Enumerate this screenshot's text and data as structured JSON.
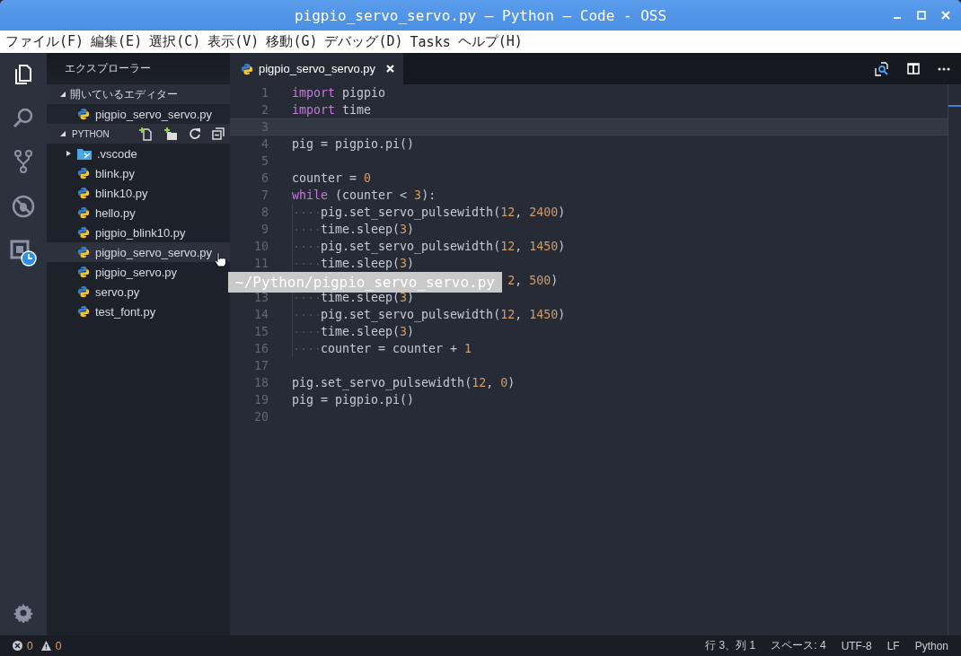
{
  "window": {
    "title": "pigpio_servo_servo.py — Python — Code - OSS"
  },
  "menu": [
    "ファイル(F)",
    "編集(E)",
    "選択(C)",
    "表示(V)",
    "移動(G)",
    "デバッグ(D)",
    "Tasks",
    "ヘルプ(H)"
  ],
  "sidebar": {
    "title": "エクスプローラー",
    "open_editors": {
      "label": "開いているエディター",
      "expanded": true,
      "files": [
        {
          "name": "pigpio_servo_servo.py",
          "hovered": false
        }
      ]
    },
    "folder": {
      "label": "PYTHON",
      "expanded": true,
      "items": [
        {
          "name": ".vscode",
          "kind": "folder",
          "expanded": false,
          "hovered": false
        },
        {
          "name": "blink.py",
          "kind": "file",
          "hovered": false
        },
        {
          "name": "blink10.py",
          "kind": "file",
          "hovered": false
        },
        {
          "name": "hello.py",
          "kind": "file",
          "hovered": false
        },
        {
          "name": "pigpio_blink10.py",
          "kind": "file",
          "hovered": false
        },
        {
          "name": "pigpio_servo_servo.py",
          "kind": "file",
          "hovered": true
        },
        {
          "name": "pigpio_servo.py",
          "kind": "file",
          "hovered": false
        },
        {
          "name": "servo.py",
          "kind": "file",
          "hovered": false
        },
        {
          "name": "test_font.py",
          "kind": "file",
          "hovered": false
        }
      ]
    }
  },
  "tabs": [
    {
      "label": "pigpio_servo_servo.py",
      "selected": true
    }
  ],
  "editor": {
    "lines": [
      {
        "number": "1",
        "current": false,
        "indented": false,
        "tokens": [
          {
            "text": "import",
            "kind": "keyword"
          },
          {
            "text": " pigpio",
            "kind": "plain"
          }
        ]
      },
      {
        "number": "2",
        "current": false,
        "indented": false,
        "tokens": [
          {
            "text": "import",
            "kind": "keyword"
          },
          {
            "text": " time",
            "kind": "plain"
          }
        ]
      },
      {
        "number": "3",
        "current": true,
        "indented": false
      },
      {
        "number": "4",
        "current": false,
        "indented": false,
        "tokens": [
          {
            "text": "pig = pigpio.pi()",
            "kind": "plain"
          }
        ]
      },
      {
        "number": "5",
        "current": false,
        "indented": false
      },
      {
        "number": "6",
        "current": false,
        "indented": false,
        "tokens": [
          {
            "text": "counter = ",
            "kind": "plain"
          },
          {
            "text": "0",
            "kind": "number"
          }
        ]
      },
      {
        "number": "7",
        "current": false,
        "indented": false,
        "tokens": [
          {
            "text": "while",
            "kind": "keyword"
          },
          {
            "text": " (counter < ",
            "kind": "plain"
          },
          {
            "text": "3",
            "kind": "number"
          },
          {
            "text": "):",
            "kind": "plain"
          }
        ]
      },
      {
        "number": "8",
        "current": false,
        "indented": true,
        "tokens": [
          {
            "text": "pig.set_servo_pulsewidth(",
            "kind": "plain"
          },
          {
            "text": "12",
            "kind": "number"
          },
          {
            "text": ", ",
            "kind": "plain"
          },
          {
            "text": "2400",
            "kind": "number"
          },
          {
            "text": ")",
            "kind": "plain"
          }
        ]
      },
      {
        "number": "9",
        "current": false,
        "indented": true,
        "tokens": [
          {
            "text": "time.sleep(",
            "kind": "plain"
          },
          {
            "text": "3",
            "kind": "number"
          },
          {
            "text": ")",
            "kind": "plain"
          }
        ]
      },
      {
        "number": "10",
        "current": false,
        "indented": true,
        "tokens": [
          {
            "text": "pig.set_servo_pulsewidth(",
            "kind": "plain"
          },
          {
            "text": "12",
            "kind": "number"
          },
          {
            "text": ", ",
            "kind": "plain"
          },
          {
            "text": "1450",
            "kind": "number"
          },
          {
            "text": ")",
            "kind": "plain"
          }
        ]
      },
      {
        "number": "11",
        "current": false,
        "indented": true,
        "tokens": [
          {
            "text": "time.sleep(",
            "kind": "plain"
          },
          {
            "text": "3",
            "kind": "number"
          },
          {
            "text": ")",
            "kind": "plain"
          }
        ]
      },
      {
        "covered": true,
        "current": false,
        "tokens": [
          {
            "text": "2",
            "kind": "number"
          },
          {
            "text": ", ",
            "kind": "plain"
          },
          {
            "text": "500",
            "kind": "number"
          },
          {
            "text": ")",
            "kind": "plain"
          }
        ]
      },
      {
        "number": "13",
        "current": false,
        "indented": true,
        "tokens": [
          {
            "text": "time.sleep(",
            "kind": "plain"
          },
          {
            "text": "3",
            "kind": "number"
          },
          {
            "text": ")",
            "kind": "plain"
          }
        ]
      },
      {
        "number": "14",
        "current": false,
        "indented": true,
        "tokens": [
          {
            "text": "pig.set_servo_pulsewidth(",
            "kind": "plain"
          },
          {
            "text": "12",
            "kind": "number"
          },
          {
            "text": ", ",
            "kind": "plain"
          },
          {
            "text": "1450",
            "kind": "number"
          },
          {
            "text": ")",
            "kind": "plain"
          }
        ]
      },
      {
        "number": "15",
        "current": false,
        "indented": true,
        "tokens": [
          {
            "text": "time.sleep(",
            "kind": "plain"
          },
          {
            "text": "3",
            "kind": "number"
          },
          {
            "text": ")",
            "kind": "plain"
          }
        ]
      },
      {
        "number": "16",
        "current": false,
        "indented": true,
        "tokens": [
          {
            "text": "counter = counter + ",
            "kind": "plain"
          },
          {
            "text": "1",
            "kind": "number"
          }
        ]
      },
      {
        "number": "17",
        "current": false,
        "indented": false
      },
      {
        "number": "18",
        "current": false,
        "indented": false,
        "tokens": [
          {
            "text": "pig.set_servo_pulsewidth(",
            "kind": "plain"
          },
          {
            "text": "12",
            "kind": "number"
          },
          {
            "text": ", ",
            "kind": "plain"
          },
          {
            "text": "0",
            "kind": "number"
          },
          {
            "text": ")",
            "kind": "plain"
          }
        ]
      },
      {
        "number": "19",
        "current": false,
        "indented": false,
        "tokens": [
          {
            "text": "pig = pigpio.pi()",
            "kind": "plain"
          }
        ]
      },
      {
        "number": "20",
        "current": false,
        "indented": false
      }
    ]
  },
  "tooltip": "~/Python/pigpio_servo_servo.py",
  "status_bar": {
    "errors": "0",
    "warnings": "0",
    "position": "行 3、列 1",
    "indentation": "スペース: 4",
    "encoding": "UTF-8",
    "eol": "LF",
    "language": "Python"
  }
}
